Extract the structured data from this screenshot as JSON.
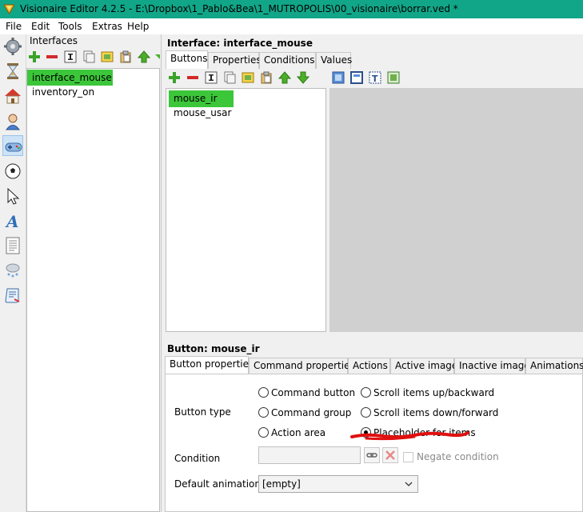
{
  "window": {
    "title": "Visionaire Editor 4.2.5 - E:\\Dropbox\\1_Pablo&Bea\\1_MUTROPOLIS\\00_visionaire\\borrar.ved *"
  },
  "menu": {
    "file": "File",
    "edit": "Edit",
    "tools": "Tools",
    "extras": "Extras",
    "help": "Help"
  },
  "rail": [
    "settings-icon",
    "hourglass-icon",
    "home-icon",
    "character-icon",
    "gamepad-icon",
    "ball-icon",
    "cursor-icon",
    "font-icon",
    "text-icon",
    "particles-icon",
    "script-icon"
  ],
  "interfaces": {
    "header": "Interfaces",
    "items": [
      "interface_mouse",
      "inventory_on"
    ]
  },
  "interface": {
    "title_prefix": "Interface: ",
    "title_name": "interface_mouse",
    "tabs": [
      "Buttons",
      "Properties",
      "Conditions",
      "Values"
    ],
    "buttons": [
      "mouse_ir",
      "mouse_usar"
    ]
  },
  "button": {
    "title_prefix": "Button: ",
    "title_name": "mouse_ir",
    "tabs": [
      "Button properties",
      "Command properties",
      "Actions",
      "Active image",
      "Inactive image",
      "Animations"
    ],
    "type_label": "Button type",
    "types": [
      "Command button",
      "Scroll items up/backward",
      "Command group",
      "Scroll items down/forward",
      "Action area",
      "Placeholder for items"
    ],
    "selected_type": "Placeholder for items",
    "condition_label": "Condition",
    "condition_value": "",
    "negate_label": "Negate condition",
    "animation_label": "Default animation",
    "animation_value": "[empty]"
  },
  "colors": {
    "titlebar": "#11a688",
    "selection": "#3cc63a",
    "annotation": "#e01010"
  }
}
